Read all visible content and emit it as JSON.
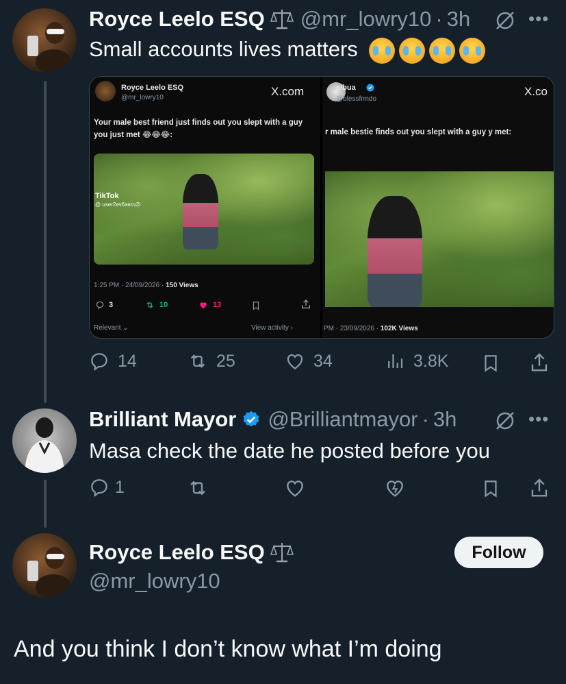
{
  "post1": {
    "name": "Royce Leelo ESQ",
    "handle": "@mr_lowry10",
    "time_sep": "·",
    "time": "3h",
    "text": "Small accounts lives matters",
    "emoji": [
      "loudly-crying-face-icon",
      "loudly-crying-face-icon",
      "loudly-crying-face-icon",
      "loudly-crying-face-icon"
    ],
    "actions": {
      "replies": "14",
      "reposts": "25",
      "likes": "34",
      "views": "3.8K"
    },
    "media": {
      "left": {
        "name": "Royce Leelo ESQ",
        "handle": "@mr_lowry10",
        "brand": "X.com",
        "text": "Your male best friend just finds out you slept with a guy you just met 😂😂😂:",
        "tiktok": "TikTok",
        "tiktok_user": "@ user2ev6xecv2i",
        "meta_time": "1:25 PM · 24/09/2026 · ",
        "meta_views": "150 Views",
        "replies": "3",
        "reposts": "10",
        "likes": "13",
        "relevant": "Relevant",
        "view_activity": "View activity"
      },
      "right": {
        "name": "sibua",
        "handle": "@blessfrmdo",
        "brand": "X.co",
        "text": "r male bestie finds out you slept with a guy y met:",
        "meta_time": "PM · 23/09/2026 · ",
        "meta_views": "102K Views"
      }
    }
  },
  "post2": {
    "name": "Brilliant Mayor",
    "handle": "@Brilliantmayor",
    "time_sep": "·",
    "time": "3h",
    "text": "Masa check the date he posted before you",
    "actions": {
      "replies": "1"
    }
  },
  "post3": {
    "name": "Royce Leelo ESQ",
    "handle": "@mr_lowry10",
    "follow_label": "Follow",
    "text": "And you think I don’t know what I’m doing"
  },
  "colors": {
    "background": "#15202b",
    "text": "#f7f9f9",
    "muted": "#8b98a5",
    "verified": "#1d9bf0",
    "like_pink": "#f91880",
    "repost_green": "#00ba7c"
  }
}
